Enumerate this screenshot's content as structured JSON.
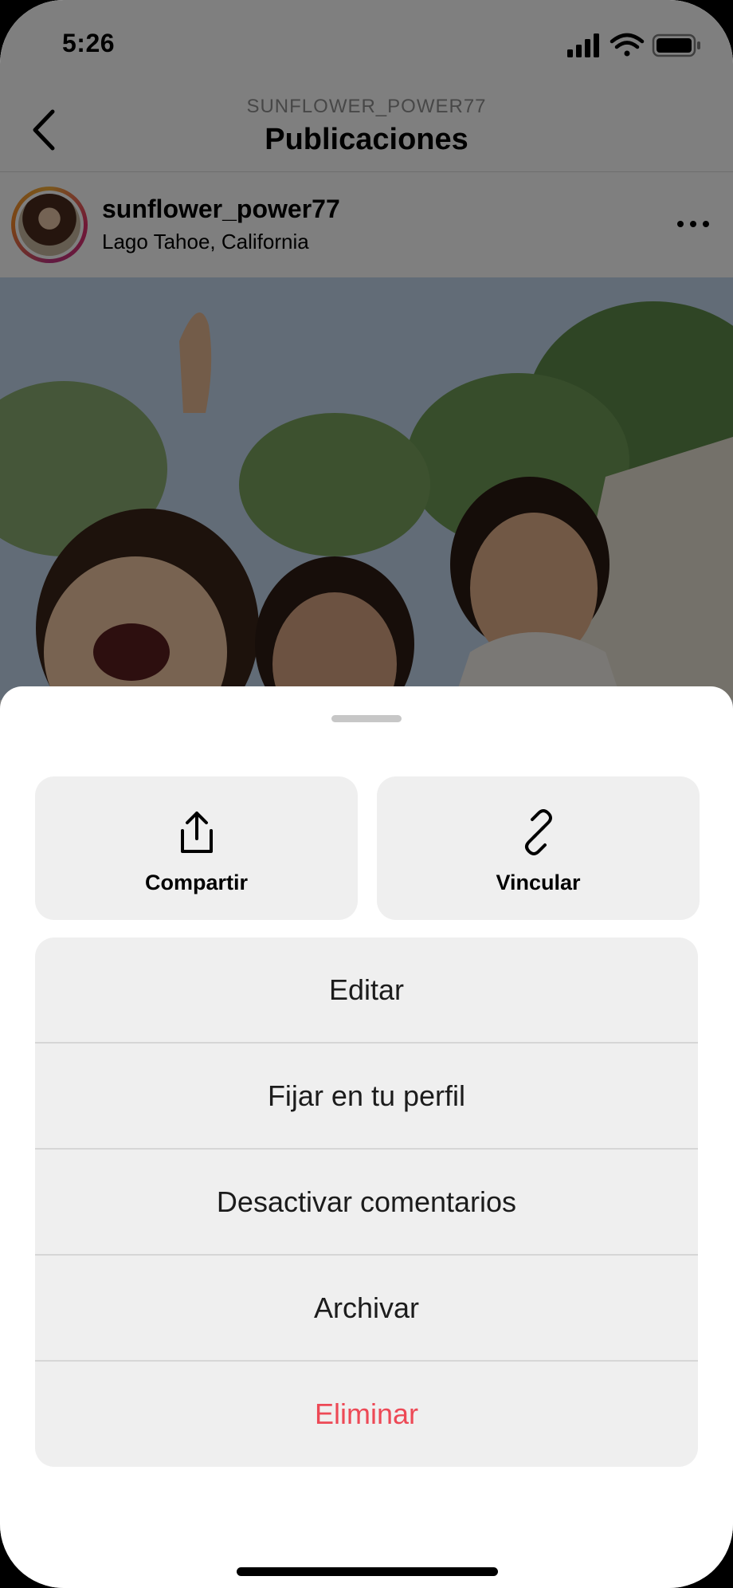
{
  "status_bar": {
    "time": "5:26"
  },
  "nav": {
    "subtitle": "SUNFLOWER_POWER77",
    "title": "Publicaciones"
  },
  "post": {
    "username": "sunflower_power77",
    "location": "Lago Tahoe, California"
  },
  "sheet": {
    "tiles": [
      {
        "label": "Compartir",
        "icon": "share-icon"
      },
      {
        "label": "Vincular",
        "icon": "link-icon"
      }
    ],
    "menu": [
      {
        "label": "Editar"
      },
      {
        "label": "Fijar en tu perfil"
      },
      {
        "label": "Desactivar comentarios"
      },
      {
        "label": "Archivar"
      },
      {
        "label": "Eliminar",
        "style": "danger"
      }
    ]
  },
  "colors": {
    "danger": "#ed4956",
    "sheet_item_bg": "#efefef",
    "overlay": "rgba(0,0,0,0.5)"
  }
}
